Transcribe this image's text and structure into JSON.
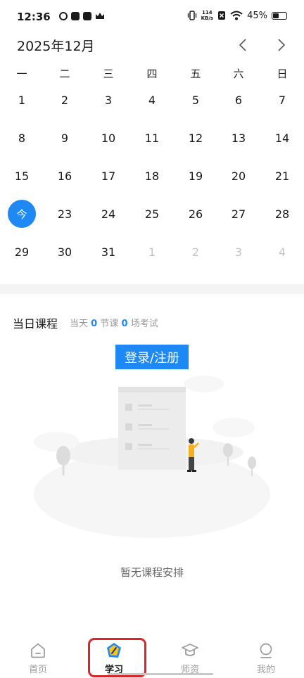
{
  "status_bar": {
    "time": "12:36",
    "net_speed_value": "114",
    "net_speed_unit": "KB/s",
    "battery_text": "45%",
    "battery_level": 0.45
  },
  "calendar": {
    "month_title": "2025年12月",
    "weekdays": [
      "一",
      "二",
      "三",
      "四",
      "五",
      "六",
      "日"
    ],
    "weeks": [
      [
        {
          "label": "1"
        },
        {
          "label": "2"
        },
        {
          "label": "3"
        },
        {
          "label": "4"
        },
        {
          "label": "5"
        },
        {
          "label": "6"
        },
        {
          "label": "7"
        }
      ],
      [
        {
          "label": "8"
        },
        {
          "label": "9"
        },
        {
          "label": "10"
        },
        {
          "label": "11"
        },
        {
          "label": "12"
        },
        {
          "label": "13"
        },
        {
          "label": "14"
        }
      ],
      [
        {
          "label": "15"
        },
        {
          "label": "16"
        },
        {
          "label": "17"
        },
        {
          "label": "18"
        },
        {
          "label": "19"
        },
        {
          "label": "20"
        },
        {
          "label": "21"
        }
      ],
      [
        {
          "label": "今",
          "today": true
        },
        {
          "label": "23"
        },
        {
          "label": "24"
        },
        {
          "label": "25"
        },
        {
          "label": "26"
        },
        {
          "label": "27"
        },
        {
          "label": "28"
        }
      ],
      [
        {
          "label": "29"
        },
        {
          "label": "30"
        },
        {
          "label": "31"
        },
        {
          "label": "1",
          "muted": true
        },
        {
          "label": "2",
          "muted": true
        },
        {
          "label": "3",
          "muted": true
        },
        {
          "label": "4",
          "muted": true
        }
      ]
    ],
    "accent_color": "#1e88f5"
  },
  "daily_courses": {
    "title": "当日课程",
    "summary_prefix": "当天",
    "lesson_count": "0",
    "lesson_unit": "节课",
    "exam_count": "0",
    "exam_unit": "场考试",
    "login_button": "登录/注册",
    "empty_text": "暂无课程安排"
  },
  "bottom_nav": {
    "tabs": [
      {
        "label": "首页",
        "icon": "home-icon"
      },
      {
        "label": "学习",
        "icon": "study-icon",
        "active": true
      },
      {
        "label": "师资",
        "icon": "graduation-cap-icon"
      },
      {
        "label": "我的",
        "icon": "profile-icon"
      }
    ],
    "highlight_color": "#d9262b"
  }
}
